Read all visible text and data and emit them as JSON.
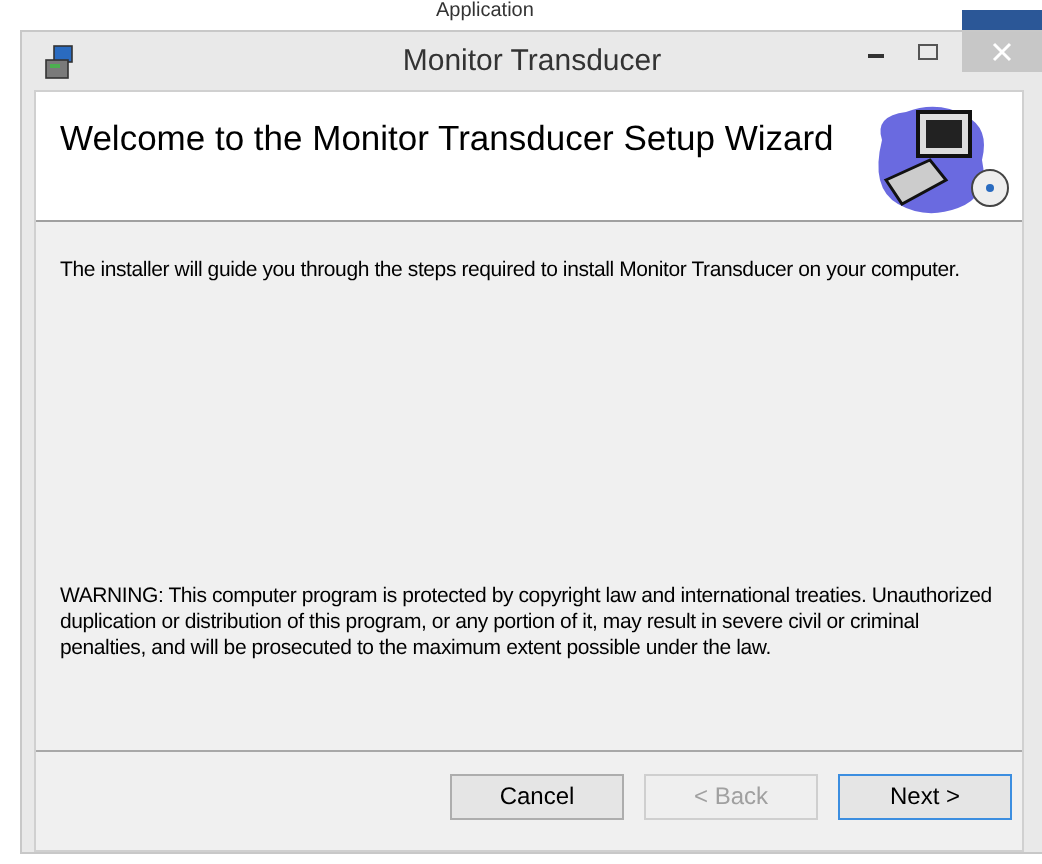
{
  "background_window": {
    "title": "Application"
  },
  "window": {
    "title": "Monitor Transducer"
  },
  "header": {
    "title": "Welcome to the Monitor Transducer Setup Wizard"
  },
  "body": {
    "intro": "The installer will guide you through the steps required to install Monitor Transducer on your computer.",
    "warning": "WARNING: This computer program is protected by copyright law and international treaties. Unauthorized duplication or distribution of this program, or any portion of it, may result in severe civil or criminal penalties, and will be prosecuted to the maximum extent possible under the law."
  },
  "buttons": [
    {
      "label": "Cancel",
      "disabled": false,
      "focused": false
    },
    {
      "label": "< Back",
      "disabled": true,
      "focused": false
    },
    {
      "label": "Next >",
      "disabled": false,
      "focused": true
    }
  ]
}
